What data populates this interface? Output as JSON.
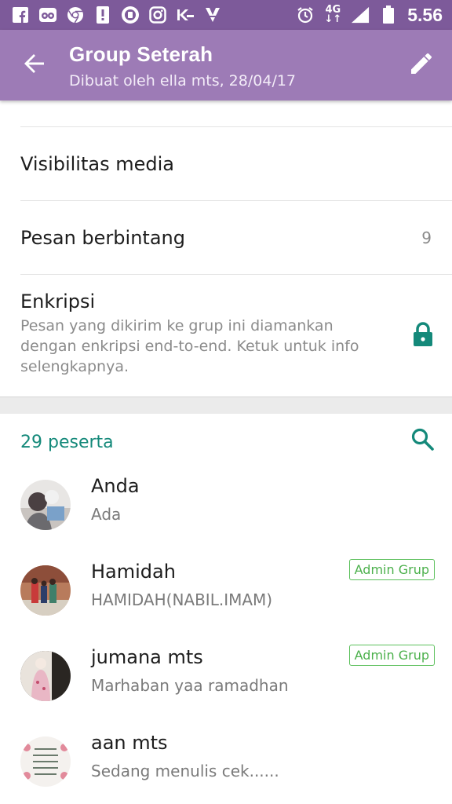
{
  "status_bar": {
    "left_icons": [
      "facebook-icon",
      "tripadvisor-icon",
      "chrome-icon",
      "notification-icon",
      "messenger-icon",
      "instagram-icon",
      "kaskus-icon",
      "path-icon"
    ],
    "alarm_icon": "alarm-icon",
    "network": "4G",
    "time": "5.56"
  },
  "app_bar": {
    "title": "Group Seterah",
    "subtitle": "Dibuat oleh ella mts, 28/04/17",
    "color": "#9d7bb6"
  },
  "settings": {
    "media_visibility_label": "Visibilitas media",
    "starred_label": "Pesan berbintang",
    "starred_count": "9",
    "encryption_label": "Enkripsi",
    "encryption_desc": "Pesan yang dikirim ke grup ini diamankan dengan enkripsi end-to-end. Ketuk untuk info selengkapnya."
  },
  "participants": {
    "count_label": "29 peserta",
    "accent": "#14897a",
    "members": [
      {
        "name": "Anda",
        "status": "Ada",
        "admin": ""
      },
      {
        "name": "Hamidah",
        "status": "HAMIDAH(NABIL.IMAM)",
        "admin": "Admin Grup"
      },
      {
        "name": "jumana mts",
        "status": "Marhaban yaa ramadhan",
        "admin": "Admin Grup"
      },
      {
        "name": "aan mts",
        "status": "Sedang menulis cek......",
        "admin": ""
      }
    ]
  }
}
